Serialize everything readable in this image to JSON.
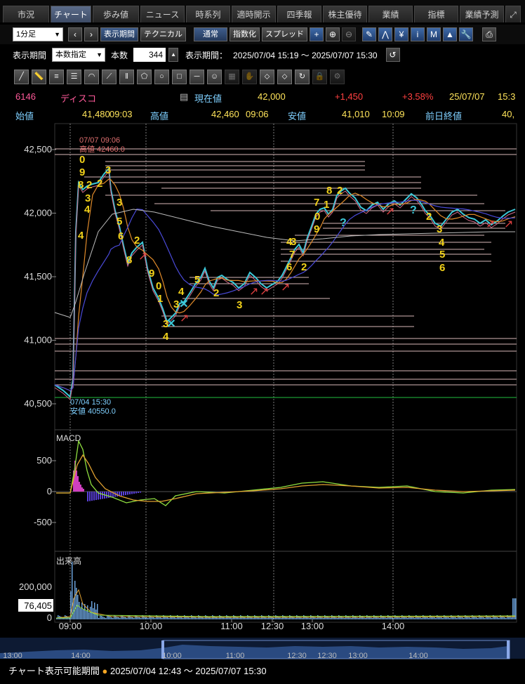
{
  "tabs": [
    "市況",
    "チャート",
    "歩み値",
    "ニュース",
    "時系列",
    "適時開示",
    "四季報",
    "株主優待",
    "業績",
    "指標",
    "業績予測"
  ],
  "toolbar": {
    "interval": "1分足",
    "period_btn": "表示期間",
    "tech_btn": "テクニカル",
    "normal": "通常",
    "index": "指数化",
    "spread": "スプレッド"
  },
  "range": {
    "label": "表示期間",
    "mode": "本数指定",
    "count_label": "本数",
    "count": "344",
    "period_label": "表示期間：",
    "period": "2025/07/04 15:19 ～ 2025/07/07 15:30"
  },
  "quote": {
    "code": "6146",
    "name": "ディスコ",
    "current_label": "現在値",
    "current": "42,000",
    "change": "+1,450",
    "change_pct": "+3.58%",
    "date": "25/07/07",
    "time": "15:3",
    "open_label": "始値",
    "open": "41,480",
    "open_time": "09:03",
    "high_label": "高値",
    "high": "42,460",
    "high_time": "09:06",
    "low_label": "安値",
    "low": "41,010",
    "low_time": "10:09",
    "prev_label": "前日終値",
    "prev": "40,"
  },
  "annotations": {
    "high_label1": "07/07 09:06",
    "high_label2": "高値 42460.0",
    "low_label1": "07/04 15:30",
    "low_label2": "安値 40550.0"
  },
  "yaxis_main": [
    "42,500",
    "42,000",
    "41,500",
    "41,000",
    "40,500"
  ],
  "macd": {
    "label": "MACD",
    "ticks": [
      "500",
      "0",
      "-500"
    ]
  },
  "volume": {
    "label": "出来高",
    "ticks": [
      "200,000",
      "0"
    ],
    "current": "76,405"
  },
  "xaxis": [
    "09:00",
    "10:00",
    "11:00",
    "12:30",
    "13:00",
    "14:00"
  ],
  "navigator": [
    "13:00",
    "14:00",
    "10:00",
    "11:00",
    "12:30",
    "13:00",
    "14:00"
  ],
  "status": {
    "label": "チャート表示可能期間",
    "period": "2025/07/04 12:43 ～ 2025/07/07 15:30"
  },
  "colors": {
    "up": "#e04040",
    "down": "#3cc8d8",
    "ma1": "#e08a2a",
    "ma2": "#4a4ad8",
    "ma3": "#bbbbbb",
    "td": "#f2d21a"
  }
}
